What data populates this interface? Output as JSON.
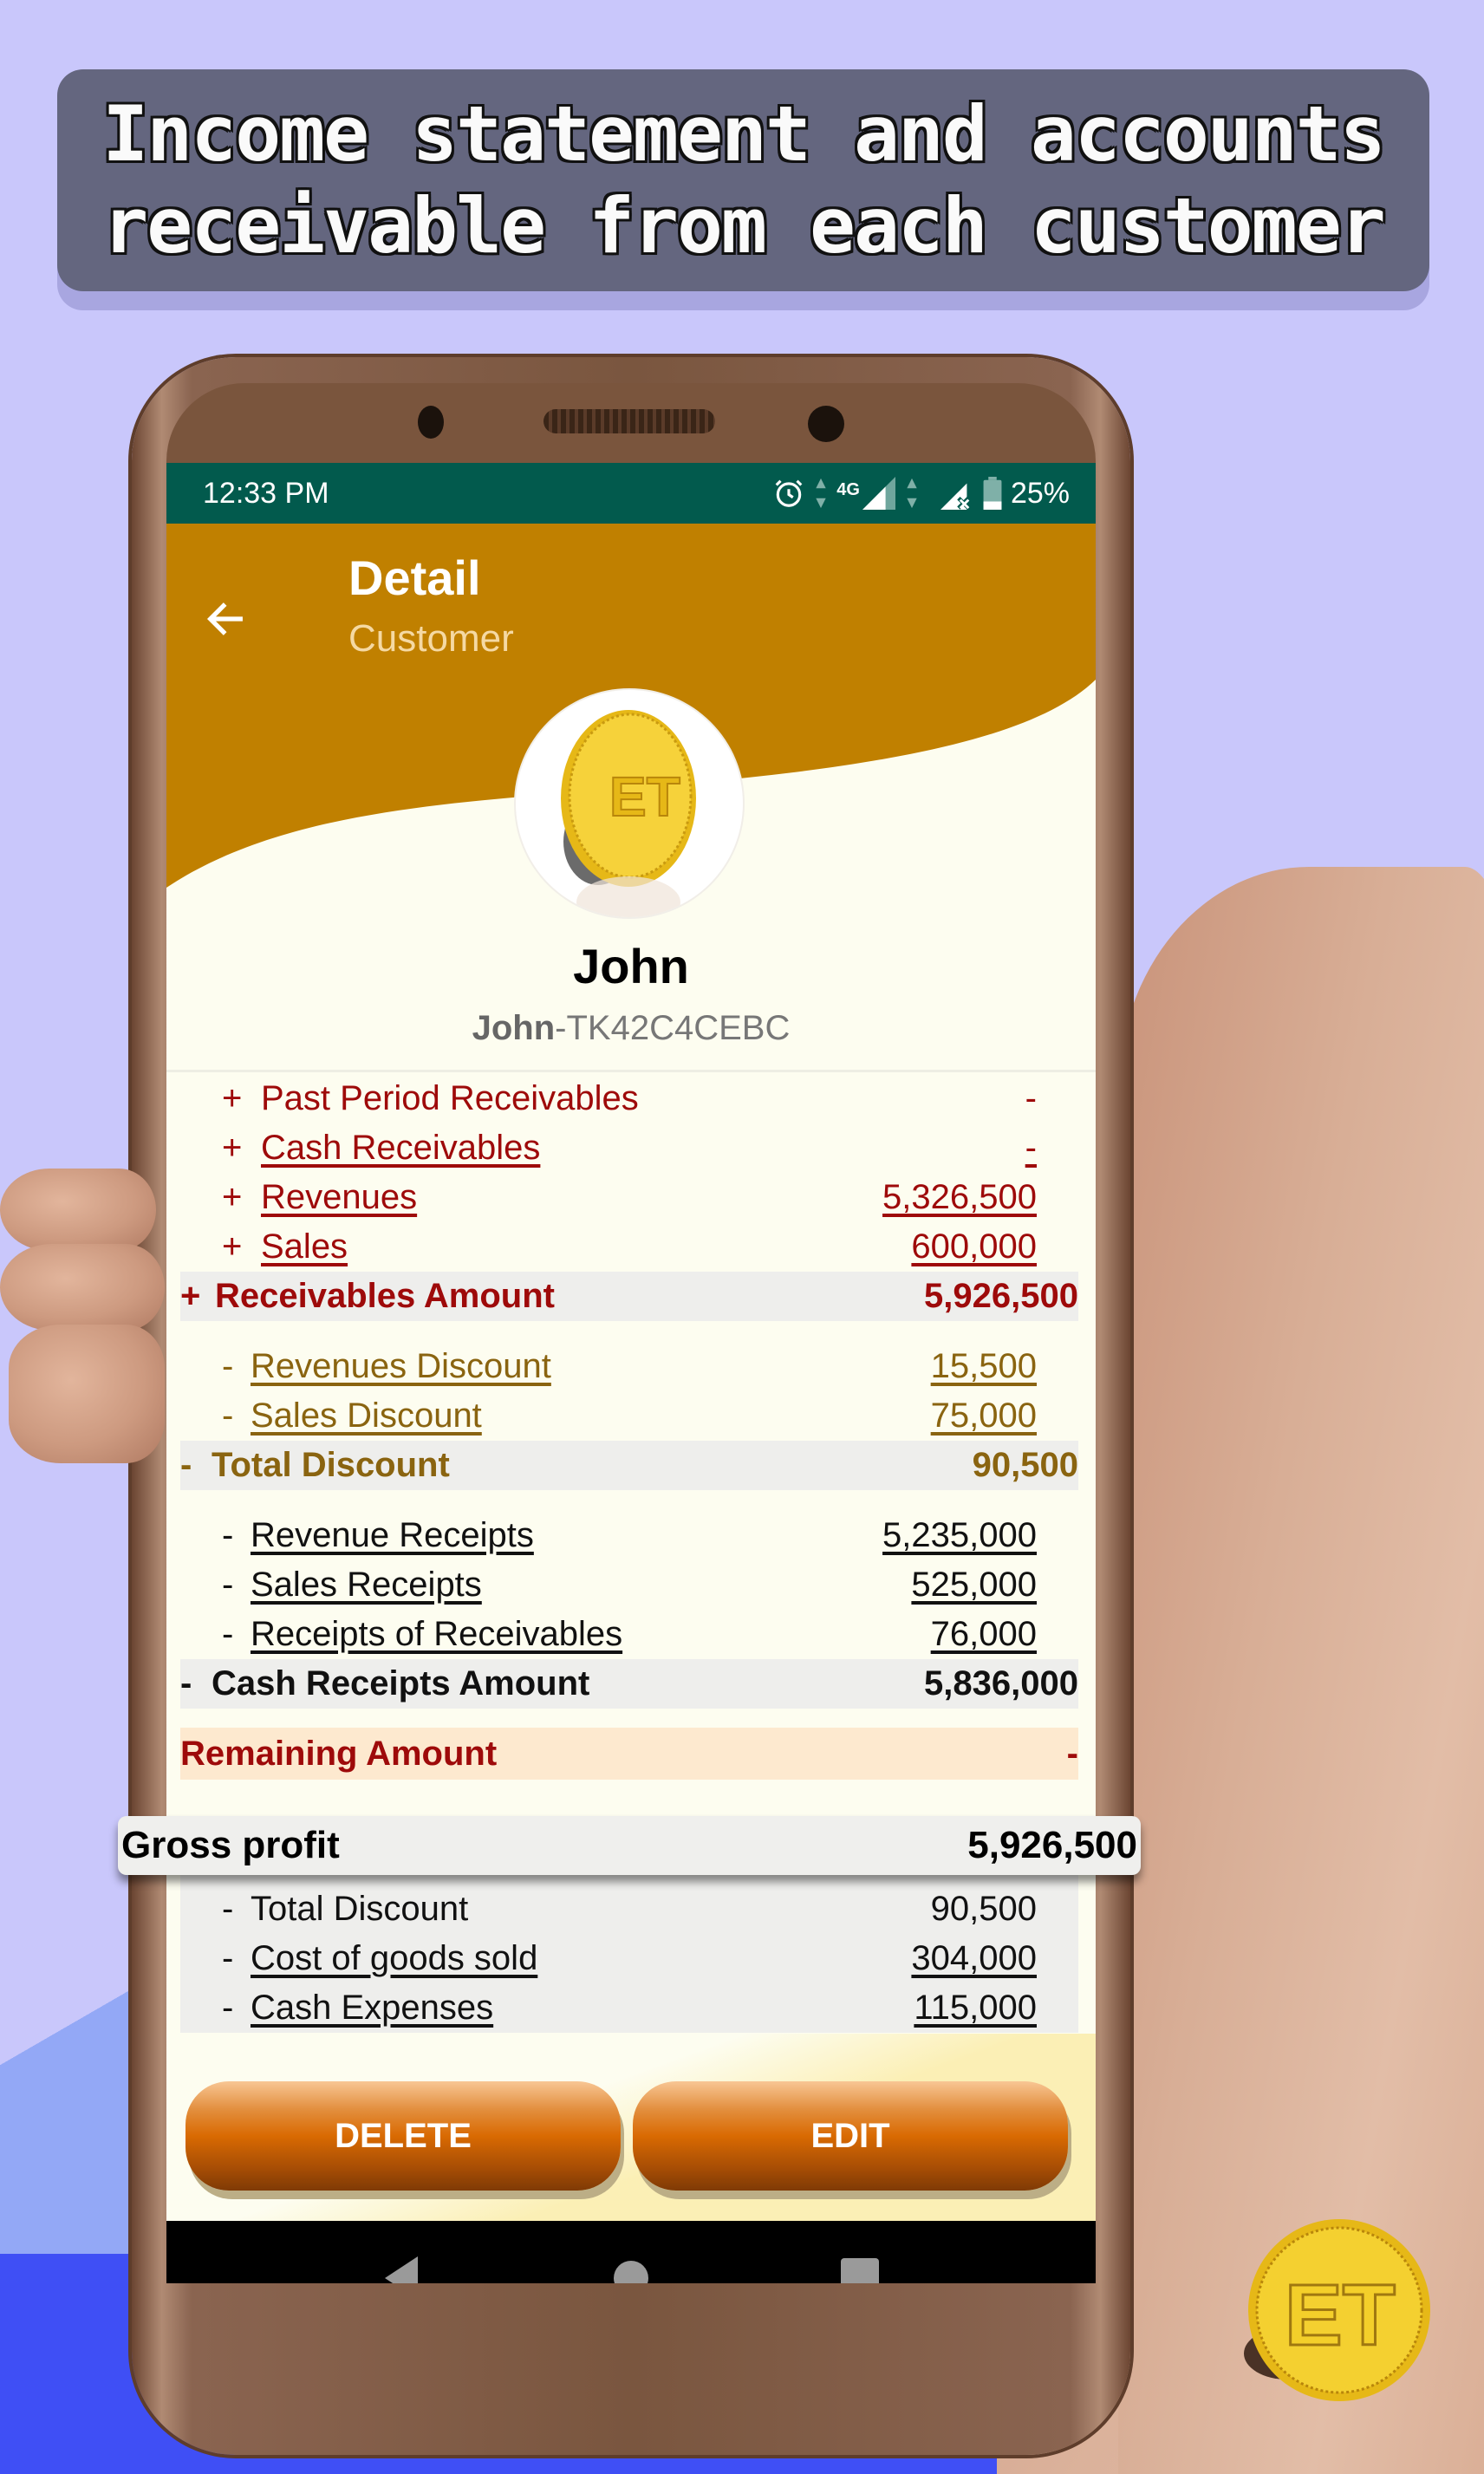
{
  "banner": {
    "line1": "Income statement and accounts",
    "line2": "receivable from each customer"
  },
  "status_bar": {
    "time": "12:33 PM",
    "network_label": "4G",
    "battery": "25%",
    "icons": [
      "alarm-icon",
      "data-arrows-icon",
      "signal-4g-icon",
      "signal-no-sim-icon",
      "battery-icon"
    ]
  },
  "app_bar": {
    "back_icon": "arrow-left-icon",
    "title": "Detail",
    "subtitle": "Customer"
  },
  "colors": {
    "status_bar": "#025a4d",
    "app_bar": "#c08000",
    "screen_bg": "#fdfdf0",
    "receivables_red": "#9e0a0a",
    "discount_gold": "#8a6410",
    "button_orange": "#d96a02"
  },
  "customer": {
    "name": "John",
    "code_prefix": "John",
    "code_suffix": "-TK42C4CEBC"
  },
  "receivables": {
    "items": [
      {
        "sign": "+",
        "label": "Past Period Receivables",
        "value": "-"
      },
      {
        "sign": "+",
        "label": "Cash Receivables",
        "value": "-"
      },
      {
        "sign": "+",
        "label": "Revenues",
        "value": "5,326,500"
      },
      {
        "sign": "+",
        "label": "Sales",
        "value": "600,000"
      }
    ],
    "total": {
      "sign": "+",
      "label": "Receivables Amount",
      "value": "5,926,500"
    }
  },
  "discounts": {
    "items": [
      {
        "sign": "-",
        "label": "Revenues Discount",
        "value": "15,500"
      },
      {
        "sign": "-",
        "label": "Sales Discount",
        "value": "75,000"
      }
    ],
    "total": {
      "sign": "-",
      "label": "Total Discount",
      "value": "90,500"
    }
  },
  "receipts": {
    "items": [
      {
        "sign": "-",
        "label": "Revenue Receipts",
        "value": "5,235,000"
      },
      {
        "sign": "-",
        "label": "Sales Receipts",
        "value": "525,000"
      },
      {
        "sign": "-",
        "label": "Receipts of Receivables",
        "value": "76,000"
      }
    ],
    "total": {
      "sign": "-",
      "label": "Cash Receipts Amount",
      "value": "5,836,000"
    }
  },
  "remaining": {
    "label": "Remaining Amount",
    "value": "-"
  },
  "gross_profit": {
    "label": "Gross profit",
    "value": "5,926,500"
  },
  "income_items": [
    {
      "sign": "-",
      "label": "Total Discount",
      "value": "90,500"
    },
    {
      "sign": "-",
      "label": "Cost of goods sold",
      "value": "304,000"
    },
    {
      "sign": "-",
      "label": "Cash Expenses",
      "value": "115,000"
    }
  ],
  "actions": {
    "delete": "DELETE",
    "edit": "EDIT"
  },
  "nav_bar": {
    "back": "nav-back-icon",
    "home": "nav-home-icon",
    "recents": "nav-recents-icon"
  }
}
